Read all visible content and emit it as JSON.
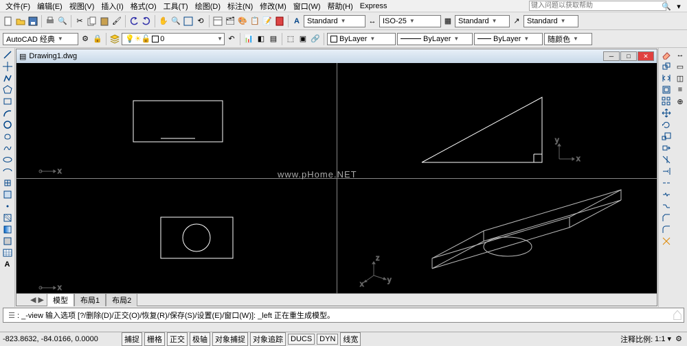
{
  "menu": {
    "items": [
      "文件(F)",
      "编辑(E)",
      "视图(V)",
      "插入(I)",
      "格式(O)",
      "工具(T)",
      "绘图(D)",
      "标注(N)",
      "修改(M)",
      "窗口(W)",
      "帮助(H)",
      "Express"
    ]
  },
  "help_placeholder": "键入问题以获取帮助",
  "toolbars": {
    "workspace_combo": "AutoCAD 经典",
    "layer_combo": "0",
    "style1": "Standard",
    "style2": "ISO-25",
    "style3": "Standard",
    "style4": "Standard",
    "bylayer1": "ByLayer",
    "bylayer2": "ByLayer",
    "bylayer3": "ByLayer",
    "color_combo": "随颜色"
  },
  "drawing": {
    "title": "Drawing1.dwg"
  },
  "tabs": {
    "model": "模型",
    "layout1": "布局1",
    "layout2": "布局2"
  },
  "cmd": {
    "text": ": _-view 输入选项 [?/删除(D)/正交(O)/恢复(R)/保存(S)/设置(E)/窗口(W)]: _left 正在重生成模型。"
  },
  "status": {
    "coords": "-823.8632, -84.0166, 0.0000",
    "buttons": [
      "捕捉",
      "栅格",
      "正交",
      "极轴",
      "对象捕捉",
      "对象追踪",
      "DUCS",
      "DYN",
      "线宽"
    ],
    "scale_label": "注释比例:",
    "scale_value": "1:1"
  },
  "watermark_center": "www.pHome.NET",
  "axes": {
    "x": "x",
    "y": "y",
    "z": "z"
  }
}
